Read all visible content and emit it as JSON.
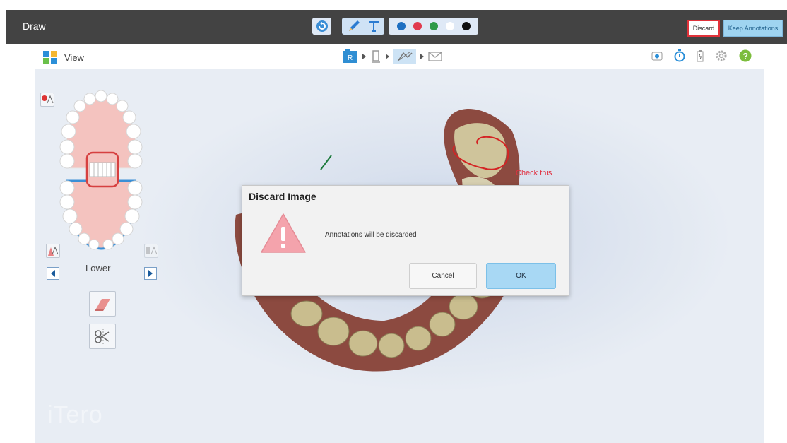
{
  "drawbar": {
    "title": "Draw",
    "discard_label": "Discard",
    "keep_label": "Keep Annotations",
    "colors": [
      "#1f6fc1",
      "#e13a4e",
      "#2e9a47",
      "#ffffff",
      "#111111"
    ]
  },
  "viewbar": {
    "view_label": "View",
    "workflow_step_r": "R"
  },
  "left_panel": {
    "jaw_label": "Lower"
  },
  "viewport": {
    "annotation_text": "Check this",
    "logo": "iTero"
  },
  "dialog": {
    "title": "Discard Image",
    "message": "Annotations will be discarded",
    "cancel_label": "Cancel",
    "ok_label": "OK"
  }
}
